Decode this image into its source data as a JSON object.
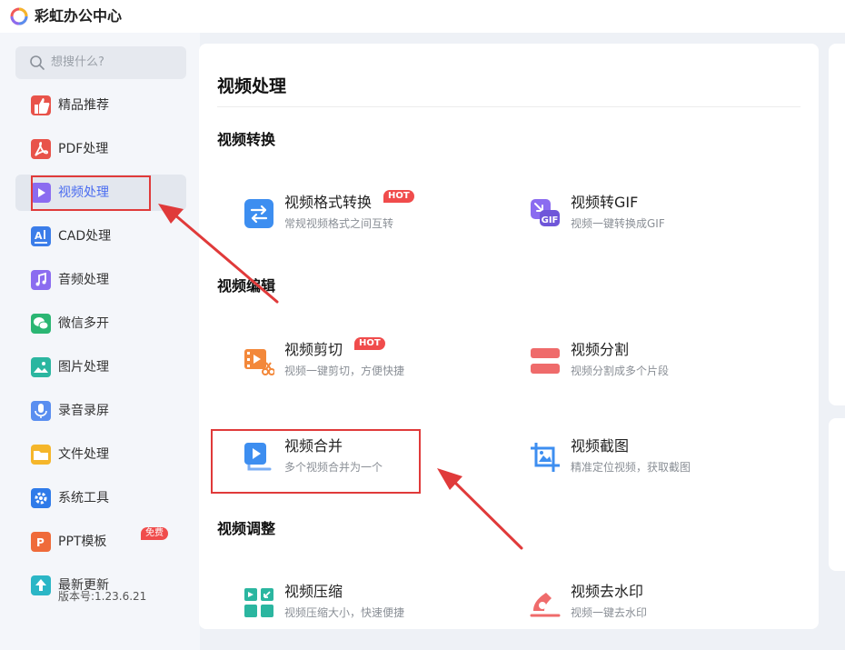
{
  "app": {
    "title": "彩虹办公中心"
  },
  "search": {
    "placeholder": "想搜什么?"
  },
  "sidebar": {
    "items": [
      {
        "label": "精品推荐",
        "icon": "thumbs-up-icon",
        "color": "#e8534a"
      },
      {
        "label": "PDF处理",
        "icon": "pdf-icon",
        "color": "#e8534a"
      },
      {
        "label": "视频处理",
        "icon": "play-icon",
        "color": "#8b6cf0"
      },
      {
        "label": "CAD处理",
        "icon": "cad-icon",
        "color": "#3b7de9"
      },
      {
        "label": "音频处理",
        "icon": "music-icon",
        "color": "#8b6cf0"
      },
      {
        "label": "微信多开",
        "icon": "wechat-icon",
        "color": "#2bb673"
      },
      {
        "label": "图片处理",
        "icon": "image-icon",
        "color": "#2bb6a0"
      },
      {
        "label": "录音录屏",
        "icon": "microphone-icon",
        "color": "#5a8ef0"
      },
      {
        "label": "文件处理",
        "icon": "folder-icon",
        "color": "#f5b62a"
      },
      {
        "label": "系统工具",
        "icon": "gear-icon",
        "color": "#2f7be9"
      },
      {
        "label": "PPT模板",
        "icon": "ppt-icon",
        "color": "#ef6b3a",
        "badge": "免费"
      },
      {
        "label": "最新更新",
        "icon": "upload-icon",
        "color": "#2bb6c6"
      }
    ],
    "active_index": 2
  },
  "version": "版本号:1.23.6.21",
  "main": {
    "title": "视频处理",
    "sections": [
      {
        "title": "视频转换",
        "tools": [
          {
            "name": "视频格式转换",
            "desc": "常规视频格式之间互转",
            "badge": "HOT",
            "icon": "convert-arrows-icon"
          },
          {
            "name": "视频转GIF",
            "desc": "视频一键转换成GIF",
            "icon": "gif-icon"
          }
        ]
      },
      {
        "title": "视频编辑",
        "tools": [
          {
            "name": "视频剪切",
            "desc": "视频一键剪切，方便快捷",
            "badge": "HOT",
            "icon": "video-cut-icon"
          },
          {
            "name": "视频分割",
            "desc": "视频分割成多个片段",
            "icon": "split-icon"
          },
          {
            "name": "视频合并",
            "desc": "多个视频合并为一个",
            "icon": "merge-icon"
          },
          {
            "name": "视频截图",
            "desc": "精准定位视频，获取截图",
            "icon": "crop-image-icon"
          }
        ]
      },
      {
        "title": "视频调整",
        "tools": [
          {
            "name": "视频压缩",
            "desc": "视频压缩大小，快速便捷",
            "icon": "compress-icon"
          },
          {
            "name": "视频去水印",
            "desc": "视频一键去水印",
            "icon": "watermark-icon"
          }
        ]
      }
    ]
  },
  "colors": {
    "accent": "#4a6cf0",
    "hot": "#f04c4c",
    "annotation": "#e03a3a"
  }
}
